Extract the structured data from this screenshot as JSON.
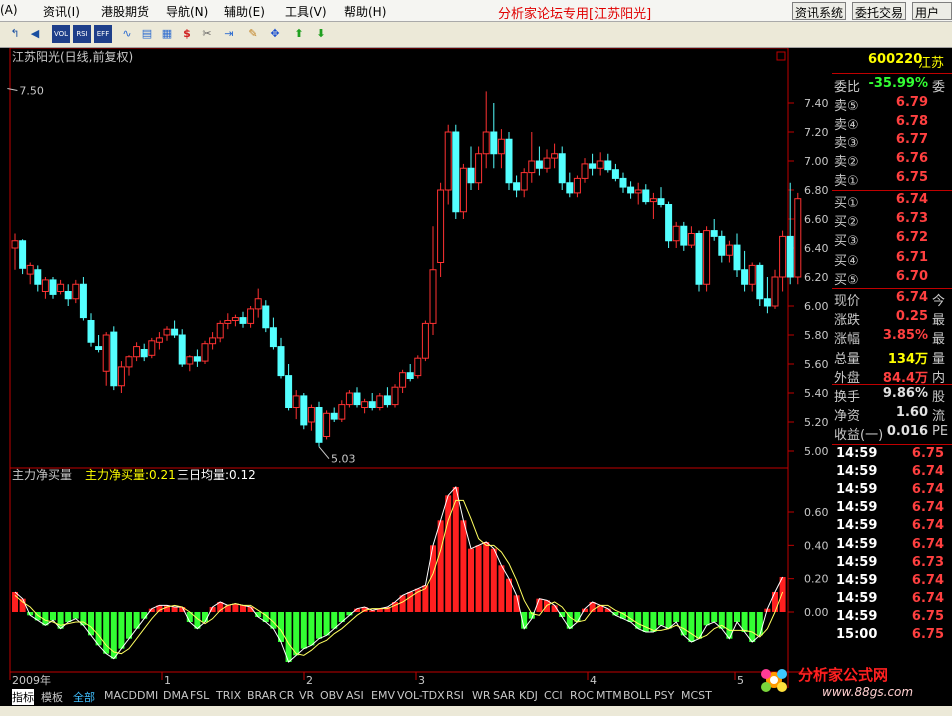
{
  "menu": {
    "items": [
      "(A)",
      "资讯(I)",
      "港股期货",
      "导航(N)",
      "辅助(E)",
      "工具(V)",
      "帮助(H)"
    ],
    "title": "分析家论坛专用[江苏阳光]",
    "buttons": [
      "资讯系统",
      "委托交易",
      "用户"
    ]
  },
  "toolbar_icons": [
    "select-icon",
    "back-icon",
    "vol-icon",
    "rsi-icon",
    "eff-icon",
    "wave-icon",
    "rsi2-icon",
    "sheet-icon",
    "chart-icon",
    "dollar-icon",
    "tool-icon",
    "import-icon",
    "pencil-icon",
    "cross-icon",
    "up-arrow-icon",
    "down-arrow-icon"
  ],
  "toolbar_labels": {
    "vol": "VOL",
    "rsi": "RSI",
    "eff": "EFF"
  },
  "main_chart": {
    "title": "江苏阳光(日线,前复权)",
    "high_label": "7.50",
    "low_label": "5.03",
    "yticks": [
      "7.40",
      "7.20",
      "7.00",
      "6.80",
      "6.60",
      "6.40",
      "6.20",
      "6.00",
      "5.80",
      "5.60",
      "5.40",
      "5.20",
      "5.00"
    ]
  },
  "indicator": {
    "name": "主力净买量",
    "v1_label": "主力净买量:0.21",
    "v2_label": "三日均量:0.12",
    "yticks": [
      "0.60",
      "0.40",
      "0.20",
      "0.00"
    ]
  },
  "xaxis": [
    "2009年",
    "1",
    "2",
    "3",
    "4",
    "5"
  ],
  "quote": {
    "code": "600220",
    "name": "江苏",
    "wb_label": "委比",
    "wb": "-35.99%",
    "wb_suffix": "委",
    "asks": [
      {
        "l": "卖⑤",
        "p": "6.79"
      },
      {
        "l": "卖④",
        "p": "6.78"
      },
      {
        "l": "卖③",
        "p": "6.77"
      },
      {
        "l": "卖②",
        "p": "6.76"
      },
      {
        "l": "卖①",
        "p": "6.75"
      }
    ],
    "bids": [
      {
        "l": "买①",
        "p": "6.74"
      },
      {
        "l": "买②",
        "p": "6.73"
      },
      {
        "l": "买③",
        "p": "6.72"
      },
      {
        "l": "买④",
        "p": "6.71"
      },
      {
        "l": "买⑤",
        "p": "6.70"
      }
    ],
    "stats": [
      {
        "l": "现价",
        "v": "6.74",
        "s": "今",
        "c": "#ff4040"
      },
      {
        "l": "涨跌",
        "v": "0.25",
        "s": "最",
        "c": "#ff4040"
      },
      {
        "l": "涨幅",
        "v": "3.85%",
        "s": "最",
        "c": "#ff4040"
      },
      {
        "l": "总量",
        "v": "134万",
        "s": "量",
        "c": "#ffff00"
      },
      {
        "l": "外盘",
        "v": "84.4万",
        "s": "内",
        "c": "#ff4040"
      },
      {
        "l": "换手",
        "v": "9.86%",
        "s": "股",
        "c": "#e0e0e0"
      },
      {
        "l": "净资",
        "v": "1.60",
        "s": "流",
        "c": "#e0e0e0"
      },
      {
        "l": "收益(一)",
        "v": "0.016",
        "s": "PE",
        "c": "#e0e0e0"
      }
    ],
    "ticks": [
      {
        "t": "14:59",
        "p": "6.75"
      },
      {
        "t": "14:59",
        "p": "6.74"
      },
      {
        "t": "14:59",
        "p": "6.74"
      },
      {
        "t": "14:59",
        "p": "6.74"
      },
      {
        "t": "14:59",
        "p": "6.74"
      },
      {
        "t": "14:59",
        "p": "6.74"
      },
      {
        "t": "14:59",
        "p": "6.73"
      },
      {
        "t": "14:59",
        "p": "6.74"
      },
      {
        "t": "14:59",
        "p": "6.74"
      },
      {
        "t": "14:59",
        "p": "6.75"
      },
      {
        "t": "15:00",
        "p": "6.75"
      }
    ]
  },
  "tabs": [
    "指标",
    "模板",
    "全部",
    "MACD",
    "DMI",
    "DMA",
    "FSL",
    "TRIX",
    "BRAR",
    "CR",
    "VR",
    "OBV",
    "ASI",
    "EMV",
    "VOL-TDX",
    "RSI",
    "WR",
    "SAR",
    "KDJ",
    "CCI",
    "ROC",
    "MTM",
    "BOLL",
    "PSY",
    "MCST"
  ],
  "logo": {
    "text": "分析家公式网",
    "url": "www.88gs.com"
  },
  "colors": {
    "up": "#ff3232",
    "down": "#54ffff",
    "bar_down": "#33ff33",
    "frame": "#c00000",
    "text": "#c8c8c8"
  },
  "chart_data": [
    {
      "type": "candlestick",
      "title": "江苏阳光(日线,前复权)",
      "ylim": [
        5.0,
        7.5
      ],
      "ohlc": [
        [
          6.4,
          6.5,
          6.25,
          6.45
        ],
        [
          6.45,
          6.46,
          6.22,
          6.26
        ],
        [
          6.22,
          6.3,
          6.15,
          6.28
        ],
        [
          6.25,
          6.28,
          6.1,
          6.15
        ],
        [
          6.1,
          6.2,
          6.05,
          6.18
        ],
        [
          6.18,
          6.2,
          6.05,
          6.08
        ],
        [
          6.1,
          6.18,
          6.08,
          6.15
        ],
        [
          6.1,
          6.15,
          6.0,
          6.05
        ],
        [
          6.05,
          6.18,
          6.02,
          6.15
        ],
        [
          6.15,
          6.2,
          5.9,
          5.92
        ],
        [
          5.9,
          5.95,
          5.72,
          5.75
        ],
        [
          5.72,
          5.8,
          5.68,
          5.7
        ],
        [
          5.55,
          5.82,
          5.45,
          5.8
        ],
        [
          5.82,
          5.86,
          5.42,
          5.45
        ],
        [
          5.45,
          5.62,
          5.4,
          5.58
        ],
        [
          5.58,
          5.66,
          5.52,
          5.65
        ],
        [
          5.65,
          5.75,
          5.62,
          5.72
        ],
        [
          5.7,
          5.74,
          5.62,
          5.65
        ],
        [
          5.66,
          5.78,
          5.64,
          5.76
        ],
        [
          5.75,
          5.82,
          5.7,
          5.78
        ],
        [
          5.8,
          5.86,
          5.76,
          5.84
        ],
        [
          5.84,
          5.9,
          5.78,
          5.8
        ],
        [
          5.8,
          5.84,
          5.58,
          5.6
        ],
        [
          5.6,
          5.66,
          5.55,
          5.65
        ],
        [
          5.65,
          5.7,
          5.58,
          5.62
        ],
        [
          5.62,
          5.76,
          5.6,
          5.74
        ],
        [
          5.74,
          5.82,
          5.7,
          5.78
        ],
        [
          5.78,
          5.9,
          5.75,
          5.88
        ],
        [
          5.88,
          5.95,
          5.84,
          5.9
        ],
        [
          5.9,
          5.94,
          5.86,
          5.92
        ],
        [
          5.92,
          5.96,
          5.85,
          5.88
        ],
        [
          5.88,
          6.0,
          5.85,
          5.98
        ],
        [
          5.98,
          6.12,
          5.92,
          6.05
        ],
        [
          6.0,
          6.04,
          5.82,
          5.85
        ],
        [
          5.85,
          5.92,
          5.7,
          5.72
        ],
        [
          5.72,
          5.78,
          5.5,
          5.52
        ],
        [
          5.52,
          5.6,
          5.28,
          5.3
        ],
        [
          5.3,
          5.42,
          5.22,
          5.38
        ],
        [
          5.38,
          5.4,
          5.15,
          5.18
        ],
        [
          5.2,
          5.32,
          5.14,
          5.3
        ],
        [
          5.3,
          5.34,
          5.03,
          5.06
        ],
        [
          5.1,
          5.28,
          5.08,
          5.26
        ],
        [
          5.26,
          5.3,
          5.2,
          5.22
        ],
        [
          5.22,
          5.35,
          5.2,
          5.32
        ],
        [
          5.32,
          5.42,
          5.3,
          5.4
        ],
        [
          5.4,
          5.44,
          5.3,
          5.32
        ],
        [
          5.3,
          5.36,
          5.26,
          5.34
        ],
        [
          5.34,
          5.4,
          5.28,
          5.3
        ],
        [
          5.3,
          5.4,
          5.28,
          5.38
        ],
        [
          5.38,
          5.44,
          5.3,
          5.32
        ],
        [
          5.32,
          5.46,
          5.3,
          5.44
        ],
        [
          5.44,
          5.56,
          5.4,
          5.54
        ],
        [
          5.54,
          5.6,
          5.48,
          5.5
        ],
        [
          5.52,
          5.66,
          5.5,
          5.64
        ],
        [
          5.64,
          5.9,
          5.62,
          5.88
        ],
        [
          5.88,
          6.55,
          5.8,
          6.25
        ],
        [
          6.3,
          6.85,
          6.2,
          6.8
        ],
        [
          6.8,
          7.25,
          6.7,
          7.2
        ],
        [
          7.2,
          7.25,
          6.6,
          6.65
        ],
        [
          6.65,
          6.98,
          6.6,
          6.95
        ],
        [
          6.95,
          7.1,
          6.8,
          6.85
        ],
        [
          6.85,
          7.1,
          6.8,
          7.05
        ],
        [
          7.05,
          7.48,
          6.95,
          7.2
        ],
        [
          7.2,
          7.4,
          6.95,
          7.05
        ],
        [
          7.05,
          7.22,
          6.95,
          7.15
        ],
        [
          7.15,
          7.2,
          6.8,
          6.85
        ],
        [
          6.85,
          6.9,
          6.75,
          6.8
        ],
        [
          6.8,
          6.95,
          6.75,
          6.92
        ],
        [
          6.92,
          7.2,
          6.85,
          7.0
        ],
        [
          7.0,
          7.1,
          6.9,
          6.95
        ],
        [
          6.95,
          7.08,
          6.92,
          7.02
        ],
        [
          7.02,
          7.12,
          6.95,
          7.05
        ],
        [
          7.05,
          7.1,
          6.8,
          6.85
        ],
        [
          6.85,
          6.92,
          6.75,
          6.78
        ],
        [
          6.78,
          6.9,
          6.75,
          6.88
        ],
        [
          6.88,
          7.02,
          6.85,
          6.98
        ],
        [
          6.98,
          7.05,
          6.9,
          6.95
        ],
        [
          6.95,
          7.06,
          6.9,
          7.0
        ],
        [
          7.0,
          7.05,
          6.92,
          6.94
        ],
        [
          6.94,
          6.98,
          6.86,
          6.88
        ],
        [
          6.88,
          6.92,
          6.78,
          6.82
        ],
        [
          6.82,
          6.86,
          6.74,
          6.78
        ],
        [
          6.78,
          6.85,
          6.7,
          6.8
        ],
        [
          6.8,
          6.84,
          6.7,
          6.72
        ],
        [
          6.72,
          6.78,
          6.6,
          6.74
        ],
        [
          6.74,
          6.82,
          6.68,
          6.7
        ],
        [
          6.7,
          6.72,
          6.4,
          6.45
        ],
        [
          6.45,
          6.58,
          6.4,
          6.55
        ],
        [
          6.55,
          6.58,
          6.38,
          6.42
        ],
        [
          6.42,
          6.55,
          6.4,
          6.5
        ],
        [
          6.5,
          6.52,
          6.1,
          6.15
        ],
        [
          6.15,
          6.55,
          6.1,
          6.52
        ],
        [
          6.52,
          6.6,
          6.45,
          6.48
        ],
        [
          6.48,
          6.52,
          6.3,
          6.35
        ],
        [
          6.35,
          6.45,
          6.3,
          6.42
        ],
        [
          6.42,
          6.5,
          6.2,
          6.25
        ],
        [
          6.25,
          6.38,
          6.1,
          6.15
        ],
        [
          6.15,
          6.3,
          6.1,
          6.28
        ],
        [
          6.28,
          6.3,
          6.0,
          6.05
        ],
        [
          6.05,
          6.2,
          5.95,
          6.0
        ],
        [
          6.0,
          6.25,
          5.98,
          6.2
        ],
        [
          6.2,
          6.52,
          6.1,
          6.48
        ],
        [
          6.48,
          6.85,
          6.15,
          6.2
        ],
        [
          6.2,
          6.78,
          6.15,
          6.74
        ]
      ],
      "last": {
        "high": 7.5,
        "low": 5.03
      }
    },
    {
      "type": "bar",
      "title": "主力净买量",
      "ylim": [
        -0.32,
        0.78
      ],
      "series": [
        {
          "name": "主力净买量",
          "values": [
            0.12,
            0.08,
            -0.02,
            -0.05,
            -0.08,
            -0.05,
            -0.1,
            -0.06,
            -0.04,
            -0.08,
            -0.14,
            -0.2,
            -0.25,
            -0.28,
            -0.22,
            -0.16,
            -0.1,
            -0.04,
            0.02,
            0.04,
            0.04,
            0.03,
            0.03,
            -0.06,
            -0.1,
            -0.06,
            0.03,
            0.06,
            0.04,
            0.05,
            0.04,
            0.03,
            -0.03,
            -0.06,
            -0.1,
            -0.18,
            -0.3,
            -0.26,
            -0.22,
            -0.2,
            -0.16,
            -0.14,
            -0.1,
            -0.06,
            -0.02,
            0.02,
            0.03,
            0.01,
            0.02,
            0.03,
            0.06,
            0.1,
            0.12,
            0.14,
            0.16,
            0.4,
            0.55,
            0.7,
            0.75,
            0.55,
            0.38,
            0.4,
            0.42,
            0.38,
            0.28,
            0.2,
            0.1,
            -0.1,
            -0.04,
            0.08,
            0.07,
            0.04,
            -0.03,
            -0.1,
            -0.06,
            0.02,
            0.06,
            0.04,
            0.02,
            -0.02,
            -0.04,
            -0.06,
            -0.1,
            -0.12,
            -0.12,
            -0.08,
            -0.1,
            -0.06,
            -0.14,
            -0.18,
            -0.16,
            -0.08,
            -0.06,
            -0.1,
            -0.16,
            -0.06,
            -0.12,
            -0.18,
            -0.14,
            0.02,
            0.12,
            0.21
          ]
        },
        {
          "name": "三日均量",
          "values": [
            0.1,
            0.06,
            0.03,
            -0.02,
            -0.05,
            -0.06,
            -0.08,
            -0.07,
            -0.06,
            -0.06,
            -0.09,
            -0.14,
            -0.2,
            -0.24,
            -0.25,
            -0.22,
            -0.16,
            -0.1,
            -0.04,
            0.01,
            0.03,
            0.04,
            0.03,
            0.0,
            -0.04,
            -0.07,
            -0.04,
            0.01,
            0.04,
            0.05,
            0.04,
            0.04,
            0.01,
            -0.02,
            -0.06,
            -0.11,
            -0.19,
            -0.25,
            -0.26,
            -0.23,
            -0.19,
            -0.17,
            -0.13,
            -0.1,
            -0.06,
            -0.02,
            0.01,
            0.02,
            0.02,
            0.02,
            0.04,
            0.06,
            0.09,
            0.12,
            0.14,
            0.23,
            0.37,
            0.55,
            0.67,
            0.67,
            0.56,
            0.44,
            0.4,
            0.4,
            0.36,
            0.29,
            0.19,
            0.07,
            -0.01,
            -0.02,
            0.04,
            0.06,
            0.03,
            -0.03,
            -0.06,
            -0.05,
            0.01,
            0.04,
            0.04,
            0.01,
            -0.01,
            -0.04,
            -0.07,
            -0.09,
            -0.11,
            -0.11,
            -0.1,
            -0.08,
            -0.1,
            -0.13,
            -0.16,
            -0.14,
            -0.1,
            -0.08,
            -0.11,
            -0.11,
            -0.11,
            -0.12,
            -0.15,
            -0.1,
            0.0,
            0.12
          ]
        }
      ]
    }
  ]
}
